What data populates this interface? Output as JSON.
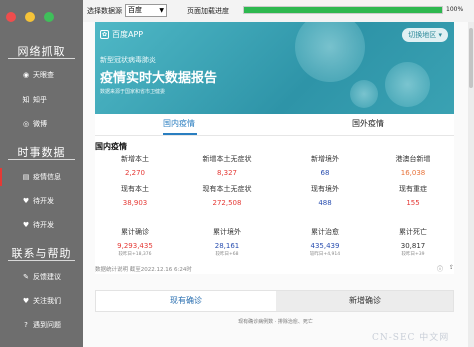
{
  "colors": {
    "sidebar_bg": "#6e6e6e",
    "progress_fill": "#2db84f",
    "accent_blue": "#2a7ec0",
    "red": "#e53935",
    "blue_value": "#2a4fb0",
    "orange": "#e8733a",
    "win_close": "#ef4d4d",
    "win_min": "#f5c338",
    "win_max": "#3fbf5a"
  },
  "sidebar": {
    "sections": [
      {
        "title": "网络抓取",
        "items": [
          {
            "label": "天眼查",
            "icon": "eye-icon"
          },
          {
            "label": "知乎",
            "icon": "zhihu-icon"
          },
          {
            "label": "微博",
            "icon": "weibo-icon"
          }
        ]
      },
      {
        "title": "时事数据",
        "items": [
          {
            "label": "疫情信息",
            "icon": "bar-icon",
            "active": true
          },
          {
            "label": "待开发",
            "icon": "heart-icon"
          },
          {
            "label": "待开发",
            "icon": "heart-icon"
          }
        ]
      },
      {
        "title": "联系与帮助",
        "items": [
          {
            "label": "反馈建议",
            "icon": "feedback-icon"
          },
          {
            "label": "关注我们",
            "icon": "heart-icon"
          },
          {
            "label": "遇到问题",
            "icon": "help-icon"
          }
        ]
      }
    ]
  },
  "topbar": {
    "select_label": "选择数据源",
    "select_value": "百度",
    "progress_label": "页面加载进度",
    "progress": 1.0,
    "progress_text": "100%"
  },
  "banner": {
    "logo": "百度APP",
    "region_button": "切换地区",
    "subtitle": "新型冠状病毒肺炎",
    "title": "疫情实时大数据报告",
    "source": "数据来源于国家和省市卫健委"
  },
  "tabs": [
    "国内疫情",
    "国外疫情"
  ],
  "domestic": {
    "title": "国内疫情",
    "stats": [
      {
        "label": "新增本土",
        "value": "2,270",
        "color": "#e53935"
      },
      {
        "label": "新增本土无症状",
        "value": "8,327",
        "color": "#e53935"
      },
      {
        "label": "新增境外",
        "value": "68",
        "color": "#2a4fb0"
      },
      {
        "label": "港澳台新增",
        "value": "16,038",
        "color": "#e8733a"
      },
      {
        "label": "现有本土",
        "value": "38,903",
        "color": "#e53935"
      },
      {
        "label": "现有本土无症状",
        "value": "272,508",
        "color": "#e53935"
      },
      {
        "label": "现有境外",
        "value": "488",
        "color": "#2a4fb0"
      },
      {
        "label": "现有重症",
        "value": "155",
        "color": "#e53935"
      },
      {
        "label": "累计确诊",
        "value": "9,293,435",
        "color": "#e53935",
        "delta": "较昨日+18,376"
      },
      {
        "label": "累计境外",
        "value": "28,161",
        "color": "#2a4fb0",
        "delta": "较昨日+68"
      },
      {
        "label": "累计治愈",
        "value": "435,439",
        "color": "#2a4fb0",
        "delta": "较昨日+4,914"
      },
      {
        "label": "累计死亡",
        "value": "30,817",
        "color": "#333333",
        "delta": "较昨日+39"
      }
    ]
  },
  "footnote": "数据统计说明 截至2022.12.16 6:24时",
  "bottom_tabs": [
    "现有确诊",
    "新增确诊"
  ],
  "chart_caption": "现有确诊病例数 · 排除治愈、死亡",
  "watermark": "CN-SEC 中文网"
}
